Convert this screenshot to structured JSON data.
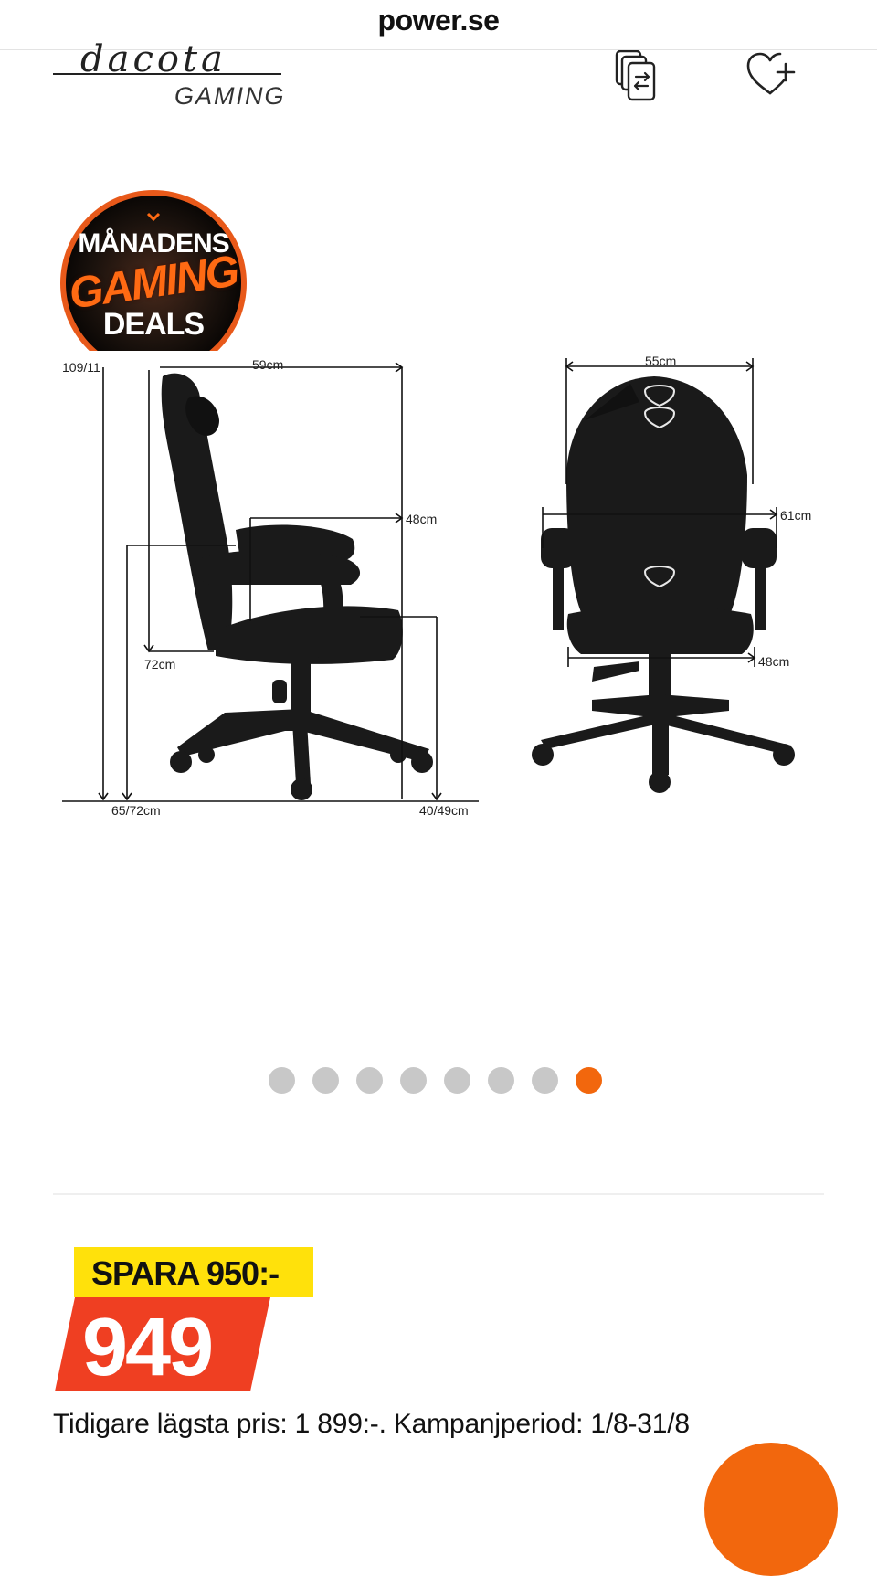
{
  "header": {
    "site": "power.se"
  },
  "brand": {
    "name": "dacota",
    "sub": "GAMING"
  },
  "actions": {
    "compare_icon": "compare-icon",
    "wishlist_icon": "heart-plus-icon"
  },
  "badge": {
    "line1": "MÅNADENS",
    "line2": "GAMING",
    "line3": "DEALS"
  },
  "dimensions": {
    "side_height": "109/11",
    "side_width": "59cm",
    "side_seat_depth": "48cm",
    "side_seat_height": "72cm",
    "side_base": "65/72cm",
    "side_seat_floor": "40/49cm",
    "front_back_width": "55cm",
    "front_arm_width": "61cm",
    "front_seat_width": "48cm"
  },
  "carousel": {
    "total": 8,
    "active": 8
  },
  "pricing": {
    "save_label": "SPARA 950:-",
    "price": "949",
    "note": "Tidigare lägsta pris: 1 899:-. Kampanjperiod: 1/8-31/8"
  },
  "colors": {
    "accent": "#f2670d",
    "save_bg": "#ffe10b",
    "price_bg": "#ef3f22"
  }
}
